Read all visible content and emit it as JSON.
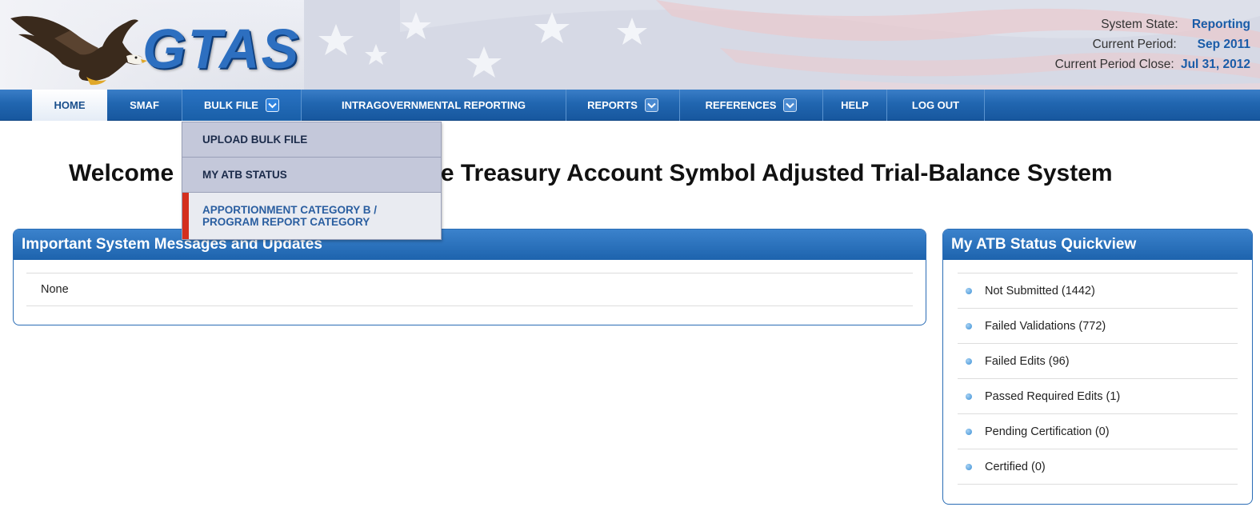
{
  "header": {
    "logo_text": "GTAS",
    "status": [
      {
        "label": "System State:",
        "value": "Reporting"
      },
      {
        "label": "Current Period:",
        "value": "Sep 2011"
      },
      {
        "label": "Current Period Close:",
        "value": "Jul 31, 2012"
      }
    ]
  },
  "nav": {
    "items": [
      {
        "label": "HOME"
      },
      {
        "label": "SMAF"
      },
      {
        "label": "BULK FILE"
      },
      {
        "label": "INTRAGOVERNMENTAL REPORTING"
      },
      {
        "label": "REPORTS"
      },
      {
        "label": "REFERENCES"
      },
      {
        "label": "HELP"
      },
      {
        "label": "LOG OUT"
      }
    ]
  },
  "dropdown": {
    "items": [
      {
        "label": "UPLOAD BULK FILE"
      },
      {
        "label": "MY ATB STATUS"
      },
      {
        "label_line1": "APPORTIONMENT CATEGORY B /",
        "label_line2": "PROGRAM REPORT CATEGORY"
      }
    ]
  },
  "welcome": {
    "text_left": "Welcome",
    "text_right": "ide Treasury Account Symbol Adjusted Trial-Balance System"
  },
  "messages_panel": {
    "title": "Important System Messages and Updates",
    "items": [
      "None"
    ]
  },
  "atb_panel": {
    "title": "My ATB Status Quickview",
    "items": [
      "Not Submitted (1442)",
      "Failed Validations (772)",
      "Failed Edits (96)",
      "Passed Required Edits (1)",
      "Pending Certification (0)",
      "Certified (0)"
    ]
  },
  "colors": {
    "nav_blue": "#2166b0",
    "status_value": "#1a5ca8",
    "dropdown_bg": "#c4c8da",
    "dropdown_highlight_bar": "#d42f1e",
    "panel_header": "#1d63ad"
  }
}
